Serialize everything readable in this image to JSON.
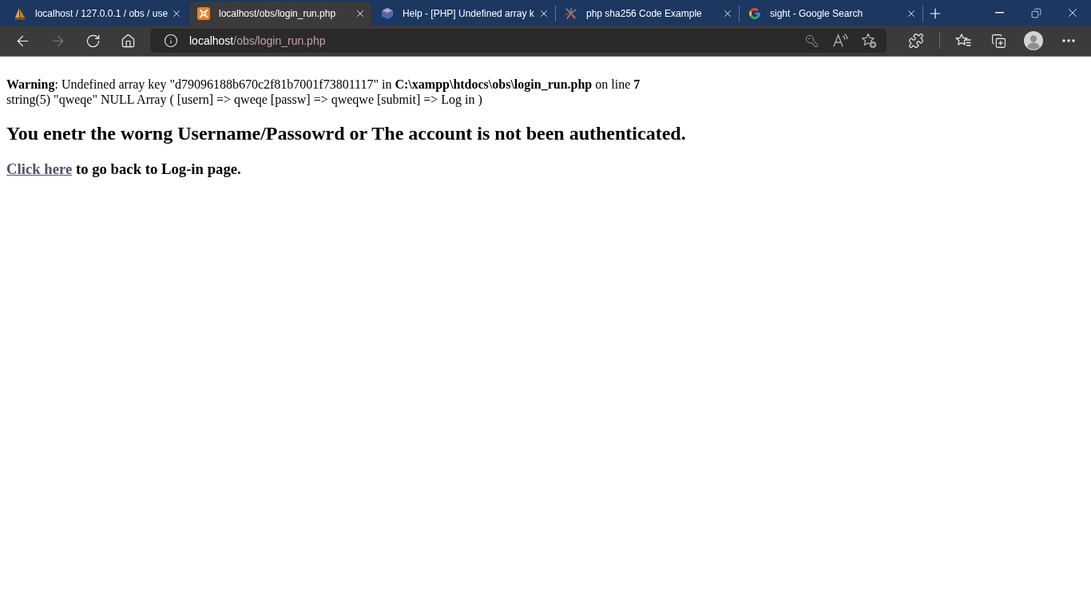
{
  "tabs": [
    {
      "title": "localhost / 127.0.0.1 / obs / use",
      "selected": false
    },
    {
      "title": "localhost/obs/login_run.php",
      "selected": true
    },
    {
      "title": "Help - [PHP] Undefined array k",
      "selected": false
    },
    {
      "title": "php sha256 Code Example",
      "selected": false
    },
    {
      "title": "sight - Google Search",
      "selected": false
    }
  ],
  "toolbar": {
    "back_disabled": false,
    "forward_disabled": true
  },
  "address_bar": {
    "host": "localhost",
    "path": "/obs/login_run.php"
  },
  "page": {
    "warning": "**Warning**: Undefined array key \"d79096188b670c2f81b7001f73801117\" in **C:\\xampp\\htdocs\\obs\\login_run.php** on line **7**",
    "dump": "string(5) \"qweqe\" NULL Array ( [usern] => qweqe [passw] => qweqwe [submit] => Log in )",
    "heading": "You enetr the worng Username/Passowrd or The account is not been authenticated.",
    "back_link": {
      "link": "Click here",
      "text": "to go back to Log-in page."
    }
  }
}
